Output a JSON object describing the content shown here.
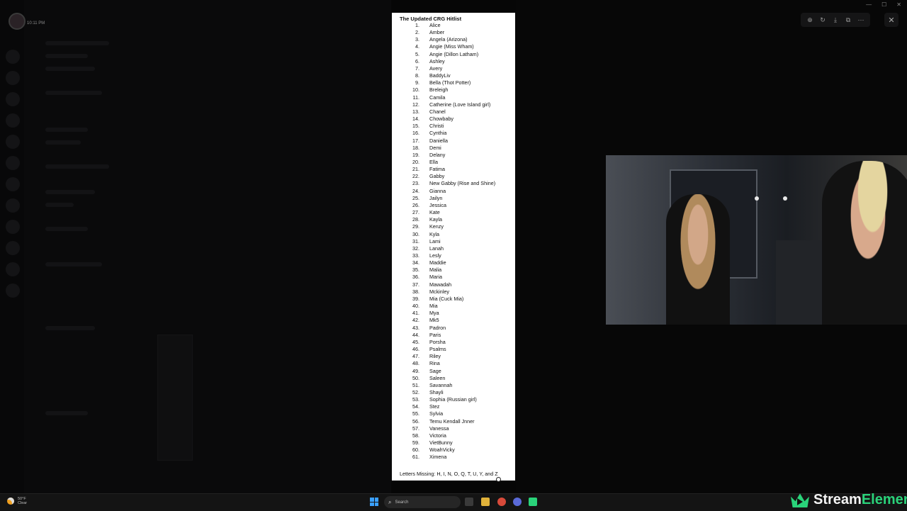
{
  "status": {
    "time": "10:11 PM"
  },
  "viewer_toolbar": {
    "icons": [
      "zoom-in-icon",
      "rotate-icon",
      "download-icon",
      "open-external-icon",
      "more-icon"
    ],
    "zoom_in": "⊕",
    "rotate": "↻",
    "download": "⤓",
    "open_external": "⧉",
    "more": "⋯",
    "close": "✕"
  },
  "document": {
    "title": "The Updated CRG Hitlist",
    "items": [
      {
        "num": "1.",
        "name": "Alice"
      },
      {
        "num": "2.",
        "name": "Amber"
      },
      {
        "num": "3.",
        "name": "Angela (Arizona)"
      },
      {
        "num": "4.",
        "name": "Angie (Miss Wham)"
      },
      {
        "num": "5.",
        "name": "Angie (Dillon Latham)"
      },
      {
        "num": "6.",
        "name": "Ashley"
      },
      {
        "num": "7.",
        "name": "Avery"
      },
      {
        "num": "8.",
        "name": "BaddyLiv"
      },
      {
        "num": "9.",
        "name": "Bella (Thot Potter)"
      },
      {
        "num": "10.",
        "name": "Breleigh"
      },
      {
        "num": "11.",
        "name": "Camila"
      },
      {
        "num": "12.",
        "name": "Catherine (Love Island girl)"
      },
      {
        "num": "13.",
        "name": "Chanel"
      },
      {
        "num": "14.",
        "name": "Chowbaby"
      },
      {
        "num": "15.",
        "name": "Christi"
      },
      {
        "num": "16.",
        "name": "Cynthia"
      },
      {
        "num": "17.",
        "name": "Daniella"
      },
      {
        "num": "18.",
        "name": "Demi"
      },
      {
        "num": "19.",
        "name": "Delany"
      },
      {
        "num": "20.",
        "name": "Ella"
      },
      {
        "num": "21.",
        "name": "Fatima"
      },
      {
        "num": "22.",
        "name": "Gabby"
      },
      {
        "num": "23.",
        "name": "New Gabby (Rise and Shine)"
      },
      {
        "num": "24.",
        "name": "Gianna"
      },
      {
        "num": "25.",
        "name": "Jailyn"
      },
      {
        "num": "26.",
        "name": "Jessica"
      },
      {
        "num": "27.",
        "name": "Kate"
      },
      {
        "num": "28.",
        "name": "Kayla"
      },
      {
        "num": "29.",
        "name": "Kenzy"
      },
      {
        "num": "30.",
        "name": "Kyla"
      },
      {
        "num": "31.",
        "name": "Lami"
      },
      {
        "num": "32.",
        "name": "Lanah"
      },
      {
        "num": "33.",
        "name": "Lesly"
      },
      {
        "num": "34.",
        "name": "Maddie"
      },
      {
        "num": "35.",
        "name": "Malia"
      },
      {
        "num": "36.",
        "name": "Maria"
      },
      {
        "num": "37.",
        "name": "Mawadah"
      },
      {
        "num": "38.",
        "name": "Mckinley"
      },
      {
        "num": "39.",
        "name": "Mia (Cuck Mia)"
      },
      {
        "num": "40.",
        "name": "Mia"
      },
      {
        "num": "41.",
        "name": "Mya"
      },
      {
        "num": "42.",
        "name": "Mk5"
      },
      {
        "num": "43.",
        "name": "Padron"
      },
      {
        "num": "44.",
        "name": "Paris"
      },
      {
        "num": "45.",
        "name": "Porsha"
      },
      {
        "num": "46.",
        "name": "Psalms"
      },
      {
        "num": "47.",
        "name": "Riley"
      },
      {
        "num": "48.",
        "name": "Rina"
      },
      {
        "num": "49.",
        "name": "Sage"
      },
      {
        "num": "50.",
        "name": "Saleen"
      },
      {
        "num": "51.",
        "name": "Savannah"
      },
      {
        "num": "52.",
        "name": "Shayli"
      },
      {
        "num": "53.",
        "name": "Sophia (Russian girl)"
      },
      {
        "num": "54.",
        "name": "Stez"
      },
      {
        "num": "55.",
        "name": "Sylvia"
      },
      {
        "num": "56.",
        "name": "Temu Kendall Jnner"
      },
      {
        "num": "57.",
        "name": "Vanessa"
      },
      {
        "num": "58.",
        "name": "Victoria"
      },
      {
        "num": "59.",
        "name": "VietBunny"
      },
      {
        "num": "60.",
        "name": "WoahVicky"
      },
      {
        "num": "61.",
        "name": "Ximena"
      }
    ],
    "footer": "Letters Missing: H, I, N, O, Q, T, U, Y, and Z"
  },
  "taskbar": {
    "weather_temp": "50°F",
    "weather_desc": "Clear",
    "search_placeholder": "Search",
    "search_icon": "⌕",
    "pinned_icons": [
      "file-explorer-icon",
      "folder-icon",
      "chrome-icon",
      "chrome-alt-icon",
      "app-icon"
    ]
  },
  "overlay": {
    "brand_prefix": "Stream",
    "brand_suffix": "Elements"
  },
  "colors": {
    "accent_green": "#2ad37a",
    "document_bg": "#ffffff",
    "taskbar_bg": "#141414"
  }
}
